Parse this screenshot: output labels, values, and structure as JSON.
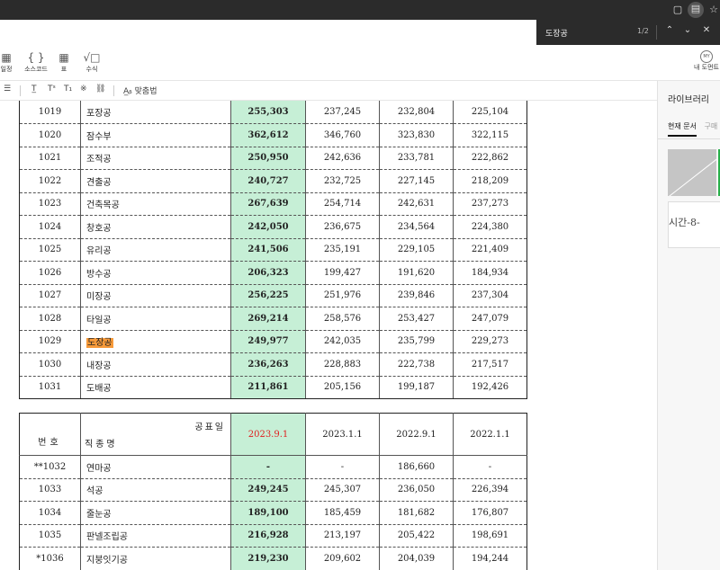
{
  "find": {
    "query": "도장공",
    "count": "1/2"
  },
  "toolbar": {
    "items": [
      {
        "label": "일정",
        "icon": "calendar-icon"
      },
      {
        "label": "소스코드",
        "icon": "code-icon"
      },
      {
        "label": "표",
        "icon": "table-icon"
      },
      {
        "label": "수식",
        "icon": "formula-icon"
      }
    ],
    "mydoc_label": "내 도먼트"
  },
  "format_bar": {
    "spellcheck_label": "맞춤법"
  },
  "library": {
    "title": "라이브러리",
    "tab_current": "현재 문서",
    "tab_purchase": "구매",
    "thumb_text": "시간-8-"
  },
  "table1": {
    "rows": [
      {
        "no": "1019",
        "name": "포장공",
        "v1": "255,303",
        "v2": "237,245",
        "v3": "232,804",
        "v4": "225,104"
      },
      {
        "no": "1020",
        "name": "잠수부",
        "v1": "362,612",
        "v2": "346,760",
        "v3": "323,830",
        "v4": "322,115"
      },
      {
        "no": "1021",
        "name": "조적공",
        "v1": "250,950",
        "v2": "242,636",
        "v3": "233,781",
        "v4": "222,862"
      },
      {
        "no": "1022",
        "name": "견출공",
        "v1": "240,727",
        "v2": "232,725",
        "v3": "227,145",
        "v4": "218,209"
      },
      {
        "no": "1023",
        "name": "건축목공",
        "v1": "267,639",
        "v2": "254,714",
        "v3": "242,631",
        "v4": "237,273"
      },
      {
        "no": "1024",
        "name": "창호공",
        "v1": "242,050",
        "v2": "236,675",
        "v3": "234,564",
        "v4": "224,380"
      },
      {
        "no": "1025",
        "name": "유리공",
        "v1": "241,506",
        "v2": "235,191",
        "v3": "229,105",
        "v4": "221,409"
      },
      {
        "no": "1026",
        "name": "방수공",
        "v1": "206,323",
        "v2": "199,427",
        "v3": "191,620",
        "v4": "184,934"
      },
      {
        "no": "1027",
        "name": "미장공",
        "v1": "256,225",
        "v2": "251,976",
        "v3": "239,846",
        "v4": "237,304"
      },
      {
        "no": "1028",
        "name": "타일공",
        "v1": "269,214",
        "v2": "258,576",
        "v3": "253,427",
        "v4": "247,079"
      },
      {
        "no": "1029",
        "name": "도장공",
        "v1": "249,977",
        "v2": "242,035",
        "v3": "235,799",
        "v4": "229,273"
      },
      {
        "no": "1030",
        "name": "내장공",
        "v1": "236,263",
        "v2": "228,883",
        "v3": "222,738",
        "v4": "217,517"
      },
      {
        "no": "1031",
        "name": "도배공",
        "v1": "211,861",
        "v2": "205,156",
        "v3": "199,187",
        "v4": "192,426"
      }
    ]
  },
  "table2": {
    "header": {
      "no": "번호",
      "name": "직종명",
      "date_label": "공표일",
      "d1": "2023.9.1",
      "d2": "2023.1.1",
      "d3": "2022.9.1",
      "d4": "2022.1.1"
    },
    "rows": [
      {
        "no": "**1032",
        "name": "연마공",
        "v1": "-",
        "v2": "-",
        "v3": "186,660",
        "v4": "-"
      },
      {
        "no": "1033",
        "name": "석공",
        "v1": "249,245",
        "v2": "245,307",
        "v3": "236,050",
        "v4": "226,394"
      },
      {
        "no": "1034",
        "name": "줄눈공",
        "v1": "189,100",
        "v2": "185,459",
        "v3": "181,682",
        "v4": "176,807"
      },
      {
        "no": "1035",
        "name": "판넬조립공",
        "v1": "216,928",
        "v2": "213,197",
        "v3": "205,422",
        "v4": "198,691"
      },
      {
        "no": "*1036",
        "name": "지붕잇기공",
        "v1": "219,230",
        "v2": "209,602",
        "v3": "204,039",
        "v4": "194,244"
      }
    ]
  }
}
